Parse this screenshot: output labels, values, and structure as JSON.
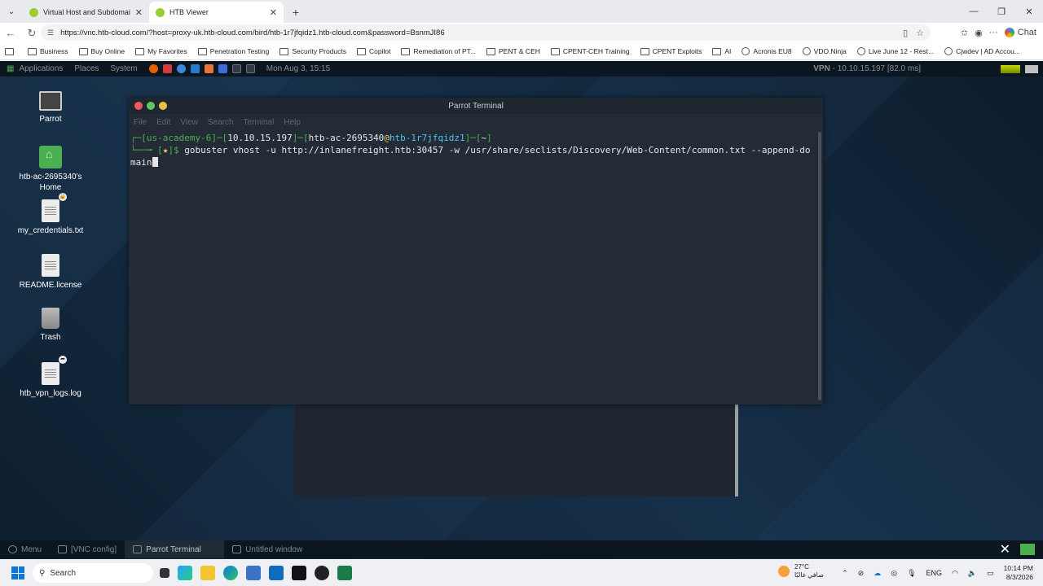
{
  "browser": {
    "tabs": [
      {
        "title": "Virtual Host and Subdomain Fuzzin",
        "active": false,
        "icon_color": "#9acd32"
      },
      {
        "title": "HTB Viewer",
        "active": true,
        "icon_color": "#9acd32"
      }
    ],
    "url": "https://vnc.htb-cloud.com/?host=proxy-uk.htb-cloud.com/bird/htb-1r7jfqidz1.htb-cloud.com&password=BsnmJI86",
    "chat_label": "Chat",
    "bookmarks": [
      "Business",
      "Buy Online",
      "My Favorites",
      "Penetration Testing",
      "Security Products",
      "Copilot",
      "Remediation of PT...",
      "PENT & CEH",
      "CPENT-CEH Training",
      "CPENT Exploits",
      "AI",
      "Acronis EU8",
      "VDO.Ninja",
      "Live June 12 - Rest...",
      "Cjwdev | AD Accou..."
    ]
  },
  "vnc": {
    "top_panel": {
      "menus": [
        "Applications",
        "Places",
        "System"
      ],
      "clock": "Mon Aug 3, 15:15",
      "vpn_label": "VPN",
      "vpn_value": " - 10.10.15.197 [82.0 ms]"
    },
    "desktop_icons": [
      {
        "label": "Parrot",
        "kind": "monitor"
      },
      {
        "label": "htb-ac-2695340's Home",
        "kind": "folder"
      },
      {
        "label": "my_credentials.txt",
        "kind": "doc"
      },
      {
        "label": "README.license",
        "kind": "doc"
      },
      {
        "label": "Trash",
        "kind": "trash"
      },
      {
        "label": "htb_vpn_logs.log",
        "kind": "doc"
      }
    ],
    "terminal": {
      "title": "Parrot Terminal",
      "menu": [
        "File",
        "Edit",
        "View",
        "Search",
        "Terminal",
        "Help"
      ],
      "prompt_user": "us-academy-6",
      "prompt_ip": "10.10.15.197",
      "prompt_login": "htb-ac-2695340",
      "prompt_host": "htb-1r7jfqidz1",
      "prompt_dir": "~",
      "status_mark": "★",
      "command_line1": "gobuster vhost -u http://inlanefreight.htb:30457 -w /usr/share/seclists/Discovery/Web-Content/common.txt --append-do",
      "command_line2": "main"
    },
    "bottom_panel": {
      "items": [
        "Menu",
        "[VNC config]",
        "Parrot Terminal",
        "Untitled window"
      ]
    }
  },
  "taskbar": {
    "search_placeholder": "Search",
    "weather_temp": "27°C",
    "weather_desc": "صافي غالبًا",
    "lang": "ENG",
    "time": "10:14 PM",
    "date": "8/3/2026"
  }
}
